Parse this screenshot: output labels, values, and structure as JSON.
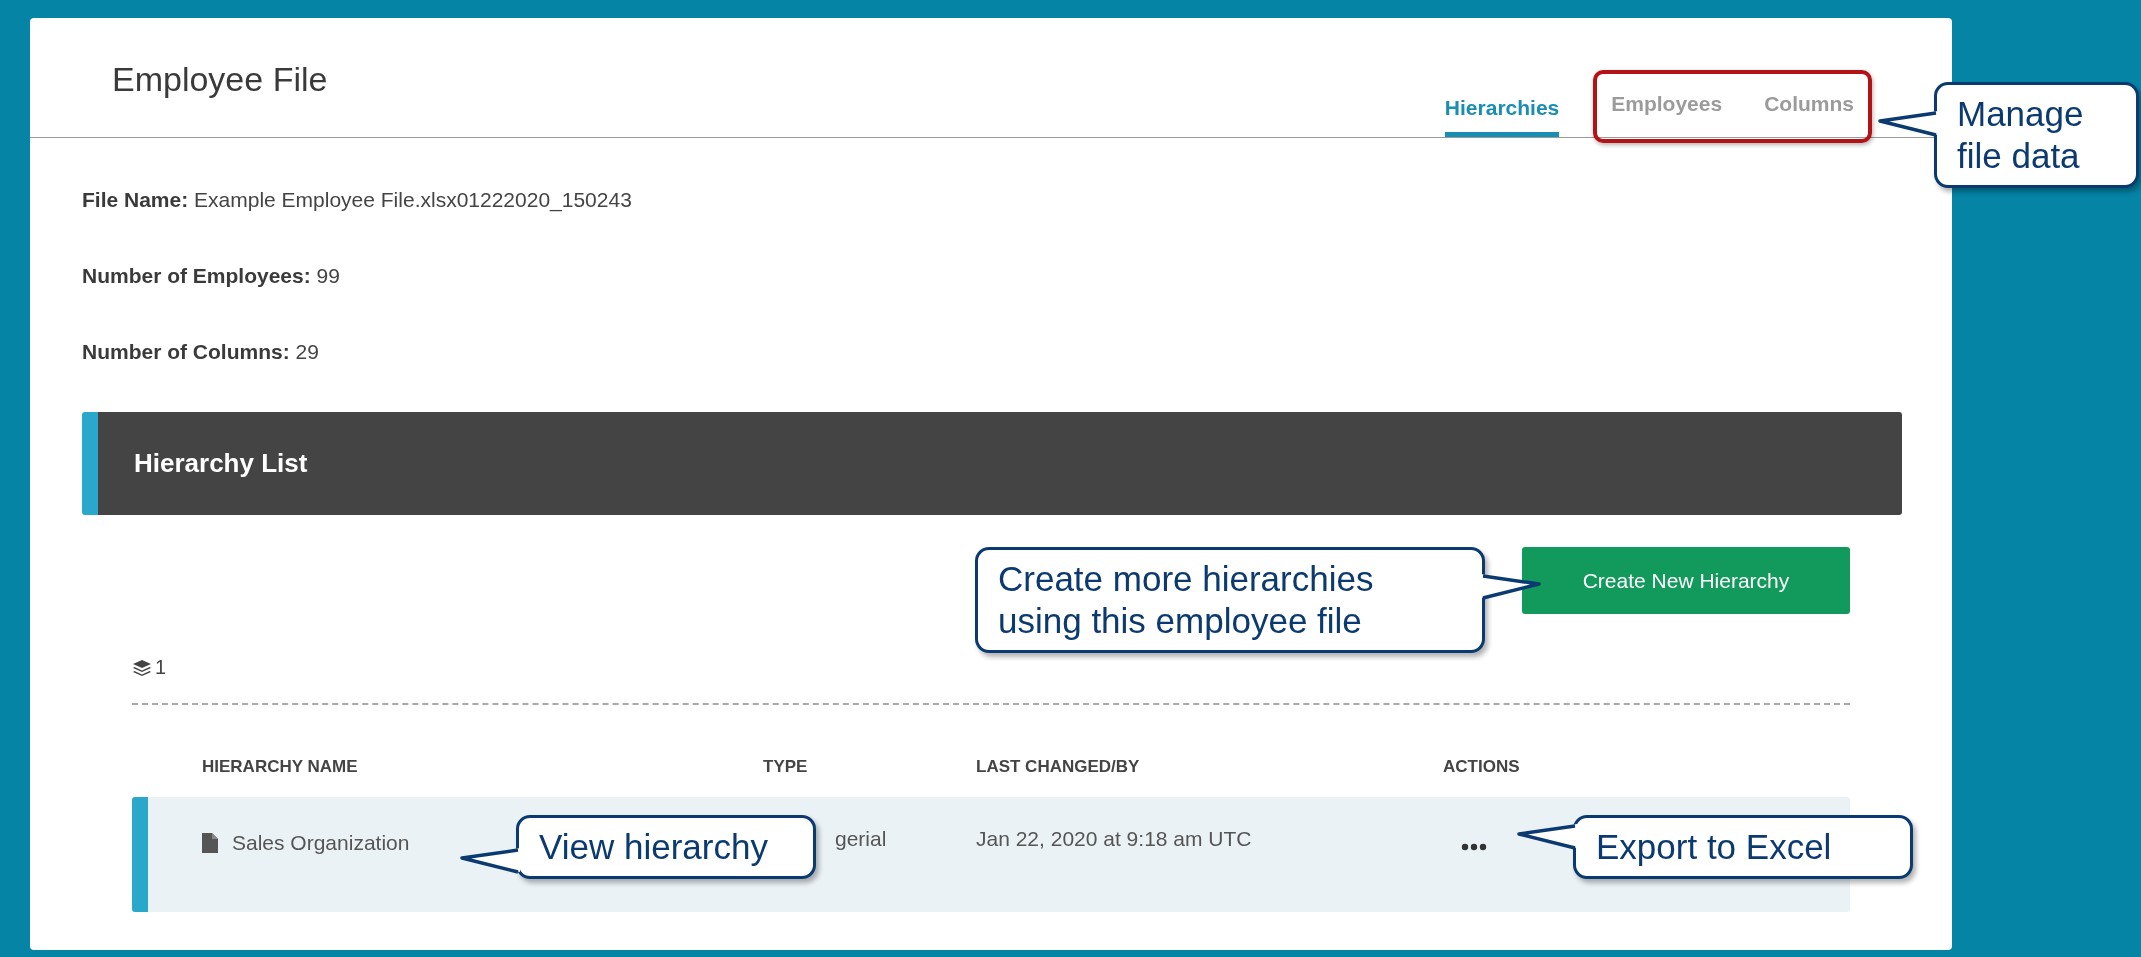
{
  "page": {
    "title": "Employee File"
  },
  "tabs": [
    {
      "label": "Hierarchies",
      "selected": true,
      "highlighted": false
    },
    {
      "label": "Employees",
      "selected": false,
      "highlighted": true
    },
    {
      "label": "Columns",
      "selected": false,
      "highlighted": true
    }
  ],
  "file_info": [
    {
      "label": "File Name:",
      "value": "Example Employee File.xlsx01222020_150243"
    },
    {
      "label": "Number of Employees:",
      "value": "99"
    },
    {
      "label": "Number of Columns:",
      "value": "29"
    }
  ],
  "hierarchy_list": {
    "title": "Hierarchy List",
    "create_button": "Create New Hierarchy",
    "count": "1",
    "columns": [
      "HIERARCHY NAME",
      "TYPE",
      "LAST CHANGED/BY",
      "ACTIONS"
    ],
    "rows": [
      {
        "name": "Sales Organization",
        "type": "gerial",
        "last_changed": "Jan 22, 2020 at 9:18 am UTC"
      }
    ]
  },
  "callouts": [
    {
      "text": "Manage file data"
    },
    {
      "text": "Create more hierarchies using this employee file"
    },
    {
      "text": "View hierarchy"
    },
    {
      "text": "Export to Excel"
    }
  ]
}
